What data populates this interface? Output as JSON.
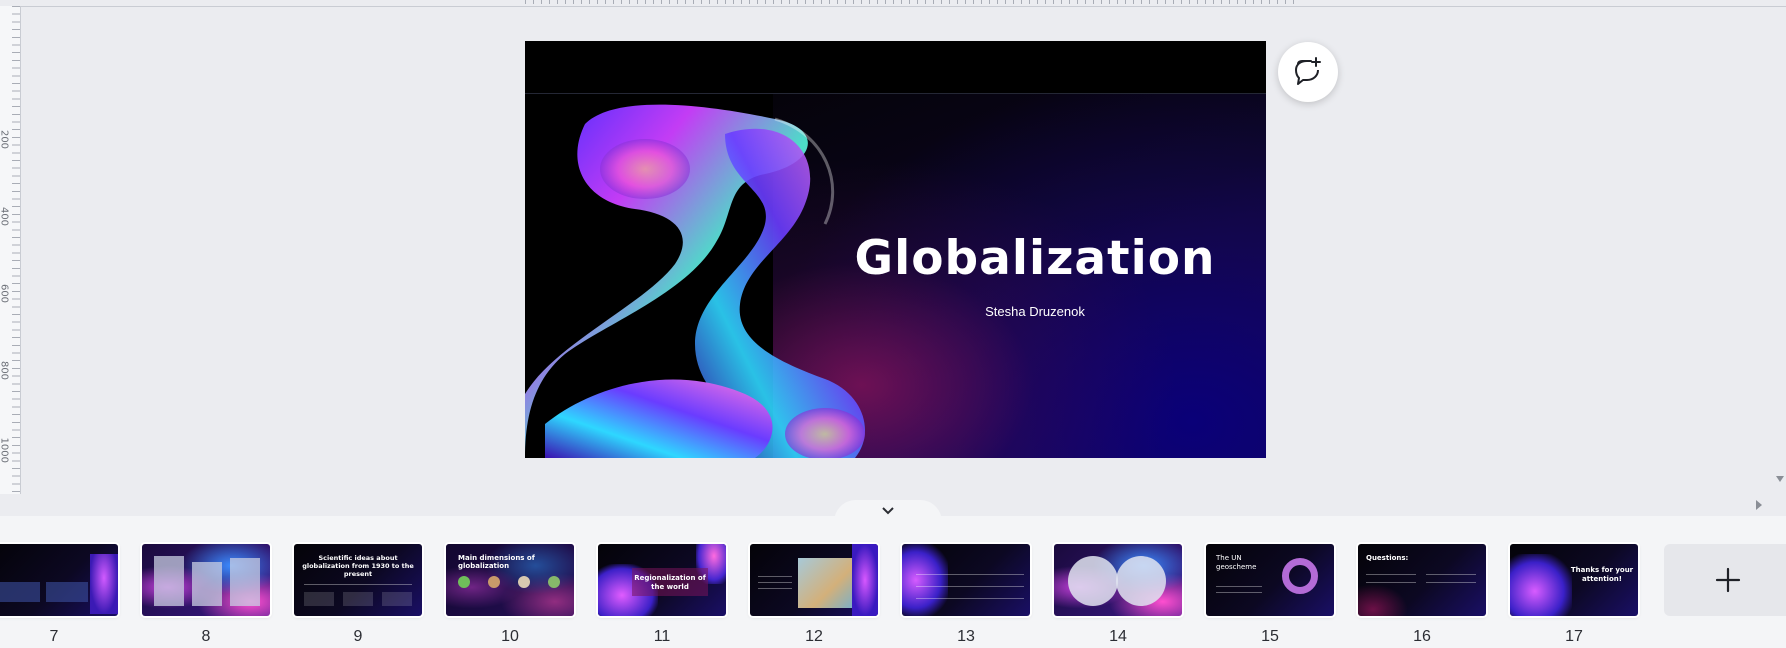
{
  "ruler": {
    "left_labels": [
      "200",
      "400",
      "600",
      "800",
      "1000"
    ]
  },
  "slide": {
    "title": "Globalization",
    "subtitle": "Stesha Druzenok"
  },
  "thumbnails": [
    {
      "num": "7",
      "title": ""
    },
    {
      "num": "8",
      "title": ""
    },
    {
      "num": "9",
      "title": "Scientific ideas about globalization from 1930 to the present"
    },
    {
      "num": "10",
      "title": "Main dimensions of globalization"
    },
    {
      "num": "11",
      "title": "Regionalization of the world"
    },
    {
      "num": "12",
      "title": ""
    },
    {
      "num": "13",
      "title": ""
    },
    {
      "num": "14",
      "title": ""
    },
    {
      "num": "15",
      "title": "The UN geoscheme"
    },
    {
      "num": "16",
      "title": "Questions:"
    },
    {
      "num": "17",
      "title": "Thanks for your attention!"
    }
  ],
  "colors": {
    "accent": "#8b3dff",
    "slide_panel": "#0e0a7a"
  },
  "icons": {
    "comment": "comment-add-icon",
    "collapse": "chevron-down-icon",
    "add": "plus-icon"
  }
}
